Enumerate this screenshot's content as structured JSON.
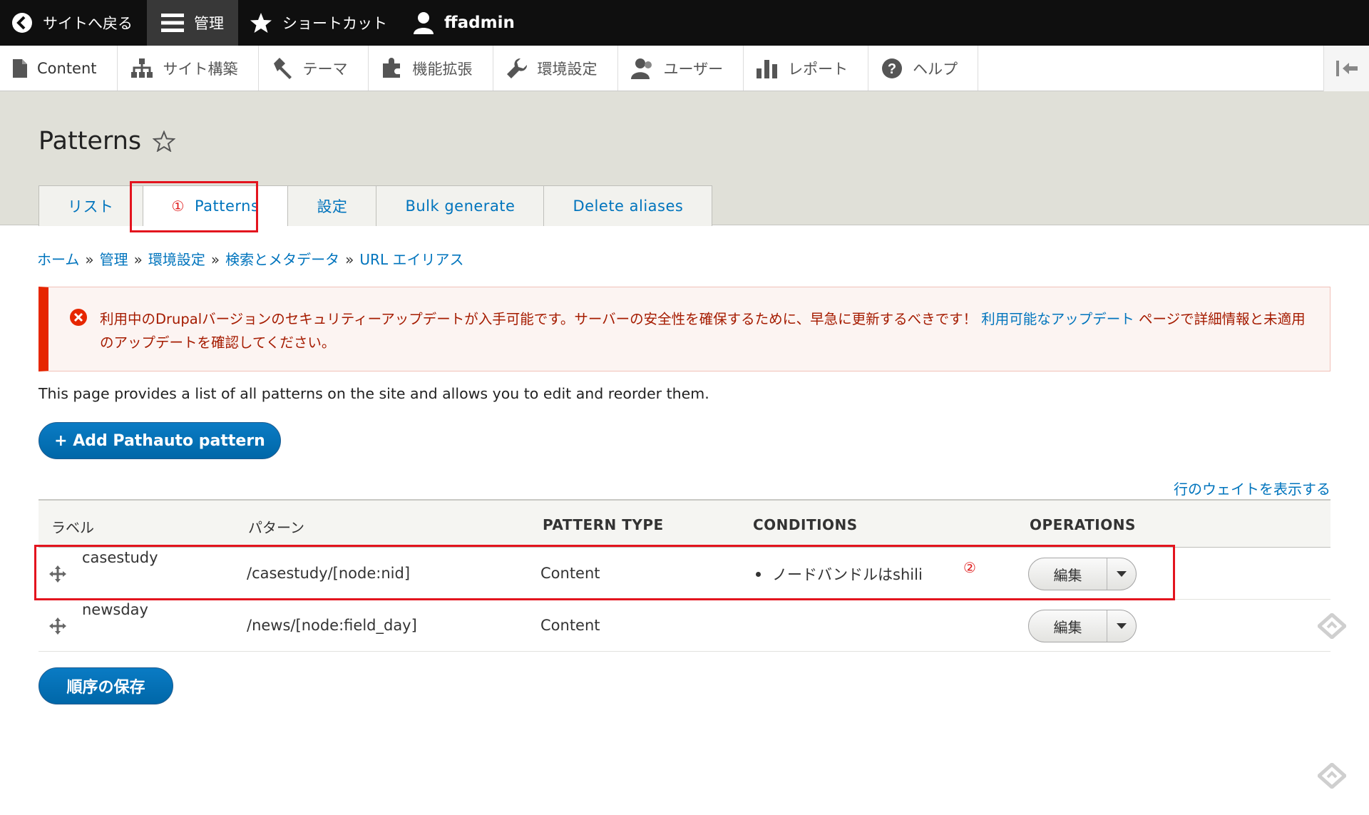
{
  "toolbar": {
    "back_label": "サイトへ戻る",
    "manage_label": "管理",
    "shortcuts_label": "ショートカット",
    "user_label": "ffadmin"
  },
  "menu": {
    "items": [
      {
        "label": "Content",
        "icon": "file-icon"
      },
      {
        "label": "サイト構築",
        "icon": "structure-icon"
      },
      {
        "label": "テーマ",
        "icon": "paintbrush-icon"
      },
      {
        "label": "機能拡張",
        "icon": "puzzle-icon"
      },
      {
        "label": "環境設定",
        "icon": "wrench-icon"
      },
      {
        "label": "ユーザー",
        "icon": "people-icon"
      },
      {
        "label": "レポート",
        "icon": "bar-chart-icon"
      },
      {
        "label": "ヘルプ",
        "icon": "help-icon"
      }
    ]
  },
  "page": {
    "title": "Patterns"
  },
  "tabs": [
    {
      "label": "リスト"
    },
    {
      "label": "Patterns",
      "annotation": "①"
    },
    {
      "label": "設定"
    },
    {
      "label": "Bulk generate"
    },
    {
      "label": "Delete aliases"
    }
  ],
  "breadcrumb": {
    "items": [
      "ホーム",
      "管理",
      "環境設定",
      "検索とメタデータ",
      "URL エイリアス"
    ],
    "separator": "»"
  },
  "alert": {
    "text_before": "利用中のDrupalバージョンのセキュリティーアップデートが入手可能です。サーバーの安全性を確保するために、早急に更新するべきです！ ",
    "link_text": "利用可能なアップデート",
    "text_after": " ページで詳細情報と未適用のアップデートを確認してください。"
  },
  "description": "This page provides a list of all patterns on the site and allows you to edit and reorder them.",
  "add_button": "+ Add Pathauto pattern",
  "show_weights_link": "行のウェイトを表示する",
  "table": {
    "headers": [
      "ラベル",
      "パターン",
      "PATTERN TYPE",
      "CONDITIONS",
      "OPERATIONS"
    ],
    "rows": [
      {
        "label": "casestudy",
        "pattern": "/casestudy/[node:nid]",
        "type": "Content",
        "condition": "ノードバンドルはshili",
        "operation": "編集"
      },
      {
        "label": "newsday",
        "pattern": "/news/[node:field_day]",
        "type": "Content",
        "condition": "",
        "operation": "編集"
      }
    ]
  },
  "annotation_2": "②",
  "save_button": "順序の保存",
  "colors": {
    "toolbar_bg": "#0f0f0f",
    "link": "#0074bd",
    "primary_button": "#0071b8",
    "alert_border": "#e62600",
    "highlight": "#e3141e"
  }
}
